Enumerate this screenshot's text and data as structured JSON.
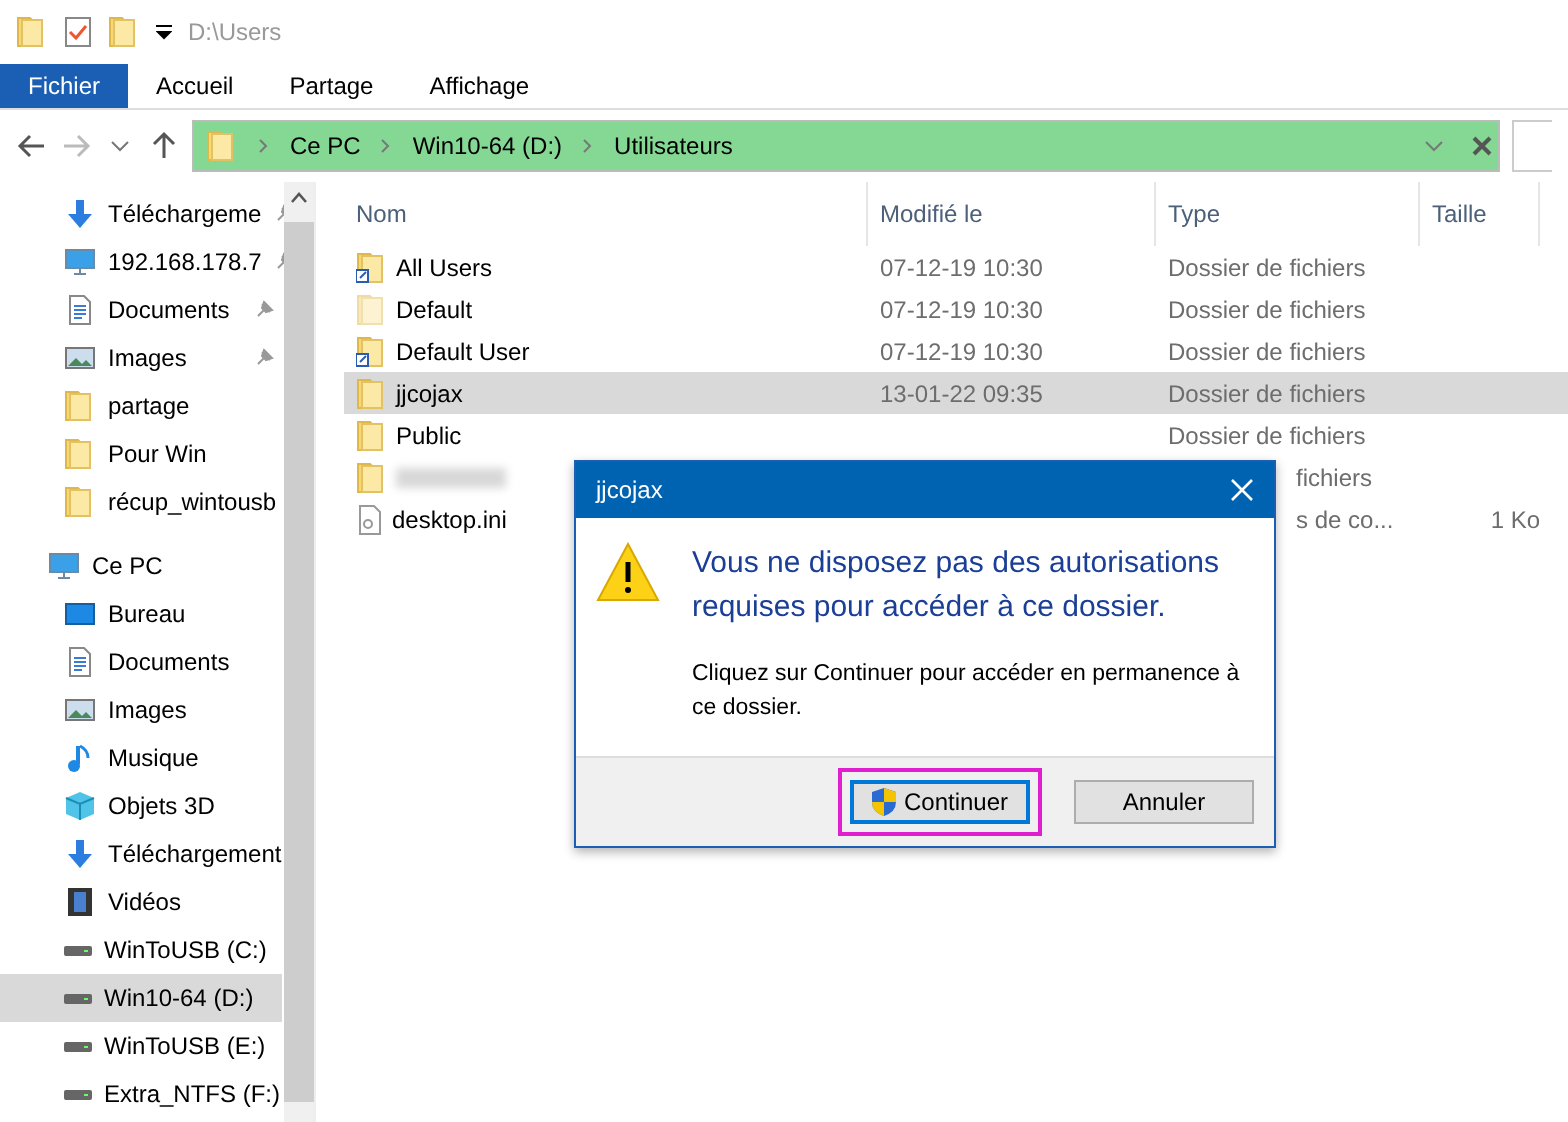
{
  "window": {
    "title": "D:\\Users"
  },
  "ribbon_tabs": [
    {
      "label": "Fichier",
      "selected": true
    },
    {
      "label": "Accueil",
      "selected": false
    },
    {
      "label": "Partage",
      "selected": false
    },
    {
      "label": "Affichage",
      "selected": false
    }
  ],
  "address_bar": {
    "crumbs": [
      "Ce PC",
      "Win10-64 (D:)",
      "Utilisateurs"
    ]
  },
  "sidebar": {
    "items": [
      {
        "label": "Téléchargeme",
        "kind": "download",
        "pinned": true,
        "selected": false
      },
      {
        "label": "192.168.178.7",
        "kind": "monitor",
        "pinned": true,
        "selected": false
      },
      {
        "label": "Documents",
        "kind": "document",
        "pinned": true,
        "selected": false
      },
      {
        "label": "Images",
        "kind": "image",
        "pinned": true,
        "selected": false
      },
      {
        "label": "partage",
        "kind": "folder",
        "pinned": false,
        "selected": false
      },
      {
        "label": "Pour Win",
        "kind": "folder",
        "pinned": false,
        "selected": false
      },
      {
        "label": "récup_wintousb",
        "kind": "folder",
        "pinned": false,
        "selected": false
      },
      {
        "label": "Ce PC",
        "kind": "computer",
        "pinned": false,
        "selected": false
      },
      {
        "label": "Bureau",
        "kind": "desktop",
        "pinned": false,
        "selected": false
      },
      {
        "label": "Documents",
        "kind": "document",
        "pinned": false,
        "selected": false
      },
      {
        "label": "Images",
        "kind": "image",
        "pinned": false,
        "selected": false
      },
      {
        "label": "Musique",
        "kind": "music",
        "pinned": false,
        "selected": false
      },
      {
        "label": "Objets 3D",
        "kind": "cube",
        "pinned": false,
        "selected": false
      },
      {
        "label": "Téléchargement",
        "kind": "download",
        "pinned": false,
        "selected": false
      },
      {
        "label": "Vidéos",
        "kind": "film",
        "pinned": false,
        "selected": false
      },
      {
        "label": "WinToUSB (C:)",
        "kind": "drive",
        "pinned": false,
        "selected": false
      },
      {
        "label": "Win10-64 (D:)",
        "kind": "drive",
        "pinned": false,
        "selected": true
      },
      {
        "label": "WinToUSB (E:)",
        "kind": "drive",
        "pinned": false,
        "selected": false
      },
      {
        "label": "Extra_NTFS (F:)",
        "kind": "drive",
        "pinned": false,
        "selected": false
      }
    ]
  },
  "file_list": {
    "columns": [
      "Nom",
      "Modifié le",
      "Type",
      "Taille"
    ],
    "rows": [
      {
        "name": "All Users",
        "modified": "07-12-19 10:30",
        "type": "Dossier de fichiers",
        "kind": "link",
        "selected": false
      },
      {
        "name": "Default",
        "modified": "07-12-19 10:30",
        "type": "Dossier de fichiers",
        "kind": "hidden",
        "selected": false
      },
      {
        "name": "Default User",
        "modified": "07-12-19 10:30",
        "type": "Dossier de fichiers",
        "kind": "link",
        "selected": false
      },
      {
        "name": "jjcojax",
        "modified": "13-01-22 09:35",
        "type": "Dossier de fichiers",
        "kind": "folder",
        "selected": true
      },
      {
        "name": "Public",
        "type": "Dossier de fichiers",
        "kind": "folder",
        "selected": false
      },
      {
        "type": "fichiers",
        "kind": "redacted",
        "selected": false
      },
      {
        "name": "desktop.ini",
        "type": "s de co...",
        "size": "1 Ko",
        "kind": "file",
        "selected": false
      }
    ]
  },
  "dialog": {
    "title": "jjcojax",
    "heading": "Vous ne disposez pas des autorisations requises pour accéder à ce dossier.",
    "message": "Cliquez sur Continuer pour accéder en permanence à ce dossier.",
    "buttons": [
      {
        "label": "Continuer",
        "kind": "shield",
        "highlighted": true
      },
      {
        "label": "Annuler",
        "kind": "plain",
        "highlighted": false
      }
    ]
  }
}
